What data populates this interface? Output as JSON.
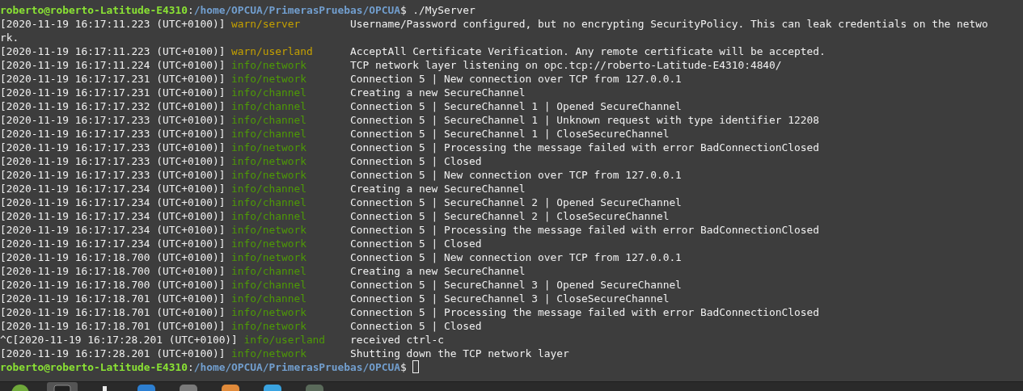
{
  "terminal": {
    "lines": [
      {
        "kind": "prompt",
        "user_host": "roberto@roberto-Latitude-E4310",
        "separator": ":",
        "path": "/home/OPCUA/PrimerasPruebas/OPCUA",
        "symbol": "$",
        "command": "./MyServer",
        "cursor": false
      },
      {
        "kind": "log",
        "timestamp": "[2020-11-19 16:17:11.223 (UTC+0100)]",
        "color": "#c4a000",
        "tag": "warn/server",
        "message": "Username/Password configured, but no encrypting SecurityPolicy. This can leak credentials on the netwo"
      },
      {
        "kind": "wrap",
        "text": "rk."
      },
      {
        "kind": "log",
        "timestamp": "[2020-11-19 16:17:11.223 (UTC+0100)]",
        "color": "#c4a000",
        "tag": "warn/userland",
        "message": "AcceptAll Certificate Verification. Any remote certificate will be accepted."
      },
      {
        "kind": "log",
        "timestamp": "[2020-11-19 16:17:11.224 (UTC+0100)]",
        "color": "#4e9a06",
        "tag": "info/network",
        "message": "TCP network layer listening on opc.tcp://roberto-Latitude-E4310:4840/"
      },
      {
        "kind": "log",
        "timestamp": "[2020-11-19 16:17:17.231 (UTC+0100)]",
        "color": "#4e9a06",
        "tag": "info/network",
        "message": "Connection 5 | New connection over TCP from 127.0.0.1"
      },
      {
        "kind": "log",
        "timestamp": "[2020-11-19 16:17:17.231 (UTC+0100)]",
        "color": "#4e9a06",
        "tag": "info/channel",
        "message": "Creating a new SecureChannel"
      },
      {
        "kind": "log",
        "timestamp": "[2020-11-19 16:17:17.232 (UTC+0100)]",
        "color": "#4e9a06",
        "tag": "info/channel",
        "message": "Connection 5 | SecureChannel 1 | Opened SecureChannel"
      },
      {
        "kind": "log",
        "timestamp": "[2020-11-19 16:17:17.233 (UTC+0100)]",
        "color": "#4e9a06",
        "tag": "info/channel",
        "message": "Connection 5 | SecureChannel 1 | Unknown request with type identifier 12208"
      },
      {
        "kind": "log",
        "timestamp": "[2020-11-19 16:17:17.233 (UTC+0100)]",
        "color": "#4e9a06",
        "tag": "info/channel",
        "message": "Connection 5 | SecureChannel 1 | CloseSecureChannel"
      },
      {
        "kind": "log",
        "timestamp": "[2020-11-19 16:17:17.233 (UTC+0100)]",
        "color": "#4e9a06",
        "tag": "info/network",
        "message": "Connection 5 | Processing the message failed with error BadConnectionClosed"
      },
      {
        "kind": "log",
        "timestamp": "[2020-11-19 16:17:17.233 (UTC+0100)]",
        "color": "#4e9a06",
        "tag": "info/network",
        "message": "Connection 5 | Closed"
      },
      {
        "kind": "log",
        "timestamp": "[2020-11-19 16:17:17.233 (UTC+0100)]",
        "color": "#4e9a06",
        "tag": "info/network",
        "message": "Connection 5 | New connection over TCP from 127.0.0.1"
      },
      {
        "kind": "log",
        "timestamp": "[2020-11-19 16:17:17.234 (UTC+0100)]",
        "color": "#4e9a06",
        "tag": "info/channel",
        "message": "Creating a new SecureChannel"
      },
      {
        "kind": "log",
        "timestamp": "[2020-11-19 16:17:17.234 (UTC+0100)]",
        "color": "#4e9a06",
        "tag": "info/channel",
        "message": "Connection 5 | SecureChannel 2 | Opened SecureChannel"
      },
      {
        "kind": "log",
        "timestamp": "[2020-11-19 16:17:17.234 (UTC+0100)]",
        "color": "#4e9a06",
        "tag": "info/channel",
        "message": "Connection 5 | SecureChannel 2 | CloseSecureChannel"
      },
      {
        "kind": "log",
        "timestamp": "[2020-11-19 16:17:17.234 (UTC+0100)]",
        "color": "#4e9a06",
        "tag": "info/network",
        "message": "Connection 5 | Processing the message failed with error BadConnectionClosed"
      },
      {
        "kind": "log",
        "timestamp": "[2020-11-19 16:17:17.234 (UTC+0100)]",
        "color": "#4e9a06",
        "tag": "info/network",
        "message": "Connection 5 | Closed"
      },
      {
        "kind": "log",
        "timestamp": "[2020-11-19 16:17:18.700 (UTC+0100)]",
        "color": "#4e9a06",
        "tag": "info/network",
        "message": "Connection 5 | New connection over TCP from 127.0.0.1"
      },
      {
        "kind": "log",
        "timestamp": "[2020-11-19 16:17:18.700 (UTC+0100)]",
        "color": "#4e9a06",
        "tag": "info/channel",
        "message": "Creating a new SecureChannel"
      },
      {
        "kind": "log",
        "timestamp": "[2020-11-19 16:17:18.700 (UTC+0100)]",
        "color": "#4e9a06",
        "tag": "info/channel",
        "message": "Connection 5 | SecureChannel 3 | Opened SecureChannel"
      },
      {
        "kind": "log",
        "timestamp": "[2020-11-19 16:17:18.701 (UTC+0100)]",
        "color": "#4e9a06",
        "tag": "info/channel",
        "message": "Connection 5 | SecureChannel 3 | CloseSecureChannel"
      },
      {
        "kind": "log",
        "timestamp": "[2020-11-19 16:17:18.701 (UTC+0100)]",
        "color": "#4e9a06",
        "tag": "info/network",
        "message": "Connection 5 | Processing the message failed with error BadConnectionClosed"
      },
      {
        "kind": "log",
        "timestamp": "[2020-11-19 16:17:18.701 (UTC+0100)]",
        "color": "#4e9a06",
        "tag": "info/network",
        "message": "Connection 5 | Closed"
      },
      {
        "kind": "log",
        "timestamp": "^C[2020-11-19 16:17:28.201 (UTC+0100)]",
        "color": "#4e9a06",
        "tag": "info/userland",
        "message": "received ctrl-c"
      },
      {
        "kind": "log",
        "timestamp": "[2020-11-19 16:17:28.201 (UTC+0100)]",
        "color": "#4e9a06",
        "tag": "info/network",
        "message": "Shutting down the TCP network layer"
      },
      {
        "kind": "prompt",
        "user_host": "roberto@roberto-Latitude-E4310",
        "separator": ":",
        "path": "/home/OPCUA/PrimerasPruebas/OPCUA",
        "symbol": "$",
        "cursor": true
      }
    ]
  },
  "taskbar": {
    "items": [
      {
        "kind": "menu",
        "selected": false
      },
      {
        "kind": "terminal",
        "selected": true
      },
      {
        "kind": "files",
        "selected": false
      },
      {
        "kind": "browser",
        "selected": false
      },
      {
        "kind": "settings",
        "selected": false
      },
      {
        "kind": "editor",
        "selected": false
      },
      {
        "kind": "chat",
        "selected": false
      },
      {
        "kind": "monitor",
        "selected": false
      }
    ]
  }
}
